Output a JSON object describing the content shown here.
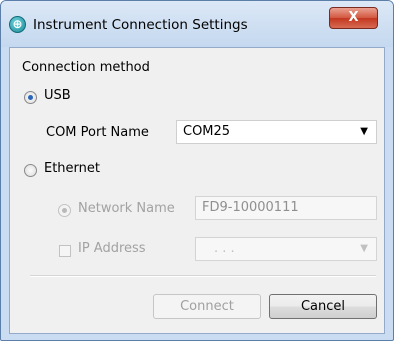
{
  "window": {
    "title": "Instrument Connection Settings",
    "close_glyph": "X"
  },
  "connection": {
    "group_label": "Connection method",
    "usb": {
      "label": "USB",
      "selected": true,
      "com_port_label": "COM Port Name",
      "com_port_value": "COM25"
    },
    "ethernet": {
      "label": "Ethernet",
      "selected": false,
      "network_name": {
        "label": "Network Name",
        "selected": true,
        "enabled": false,
        "value": "FD9-10000111"
      },
      "ip_address": {
        "label": "IP Address",
        "checked": false,
        "enabled": false,
        "value": ".   .   ."
      }
    }
  },
  "buttons": {
    "connect_label": "Connect",
    "connect_enabled": false,
    "cancel_label": "Cancel"
  },
  "colors": {
    "title_bar": "#c9dcf1",
    "close_button": "#c3371f",
    "dialog_body": "#f0f0f0",
    "radio_dot": "#2a66b8"
  }
}
